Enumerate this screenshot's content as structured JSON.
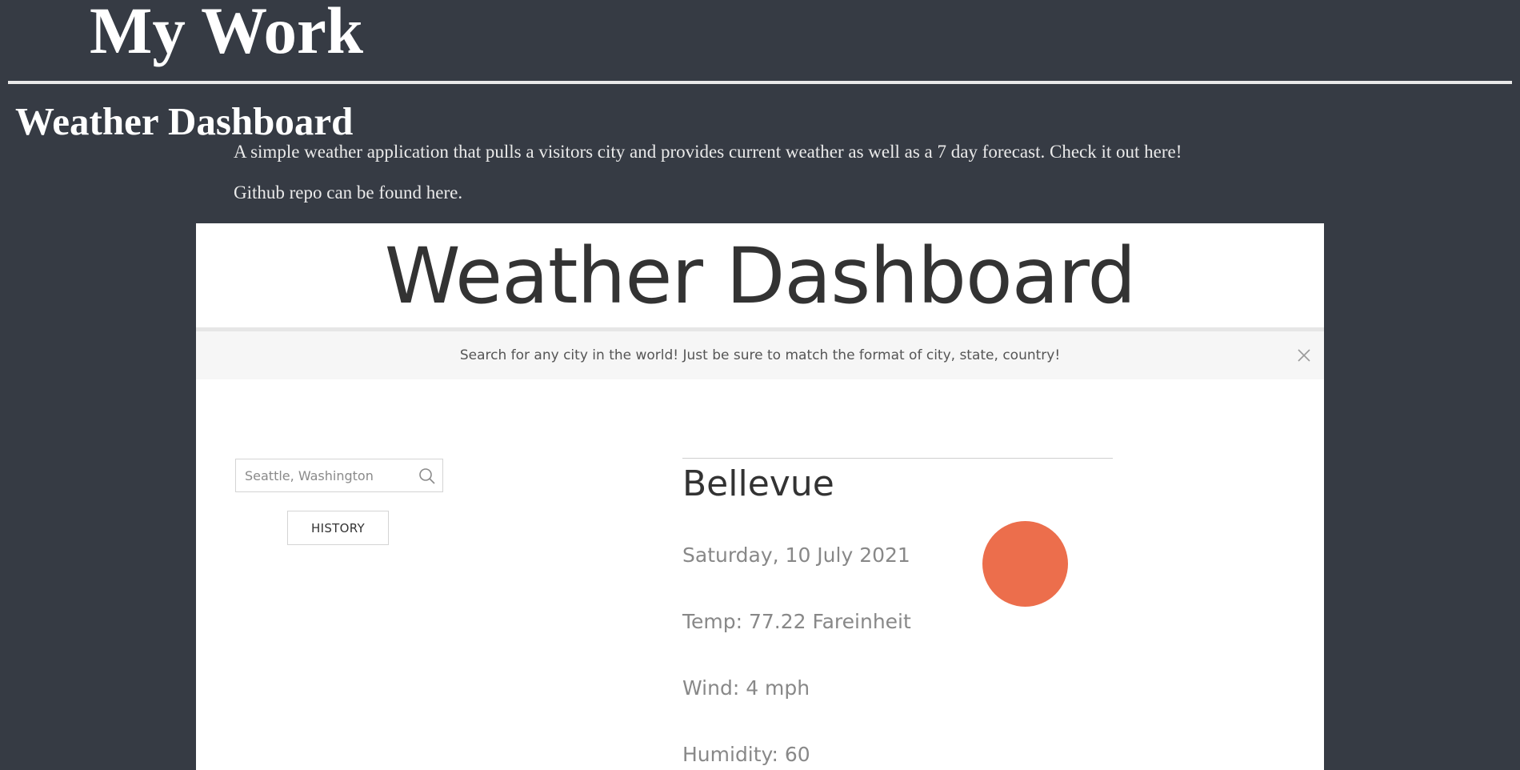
{
  "page": {
    "title": "My Work"
  },
  "project": {
    "heading": "Weather Dashboard",
    "description": "A simple weather application that pulls a visitors city and provides current weather as well as a 7 day forecast. Check it out here!",
    "repo_text": "Github repo can be found here."
  },
  "app": {
    "title": "Weather Dashboard",
    "notice": "Search for any city in the world! Just be sure to match the format of city, state, country!",
    "close_icon": "close-icon",
    "search": {
      "placeholder": "Seattle, Washington",
      "icon": "search-icon"
    },
    "history_label": "HISTORY",
    "weather": {
      "city": "Bellevue",
      "date": "Saturday, 10 July 2021",
      "temp": "Temp: 77.22 Fareinheit",
      "wind": "Wind: 4 mph",
      "humidity": "Humidity: 60",
      "icon": "sun-icon",
      "icon_color": "#ec6e4c"
    }
  },
  "colors": {
    "page_background": "#363b44",
    "screenshot_background": "#ffffff",
    "notice_background": "#f6f6f6",
    "accent": "#ec6e4c"
  }
}
